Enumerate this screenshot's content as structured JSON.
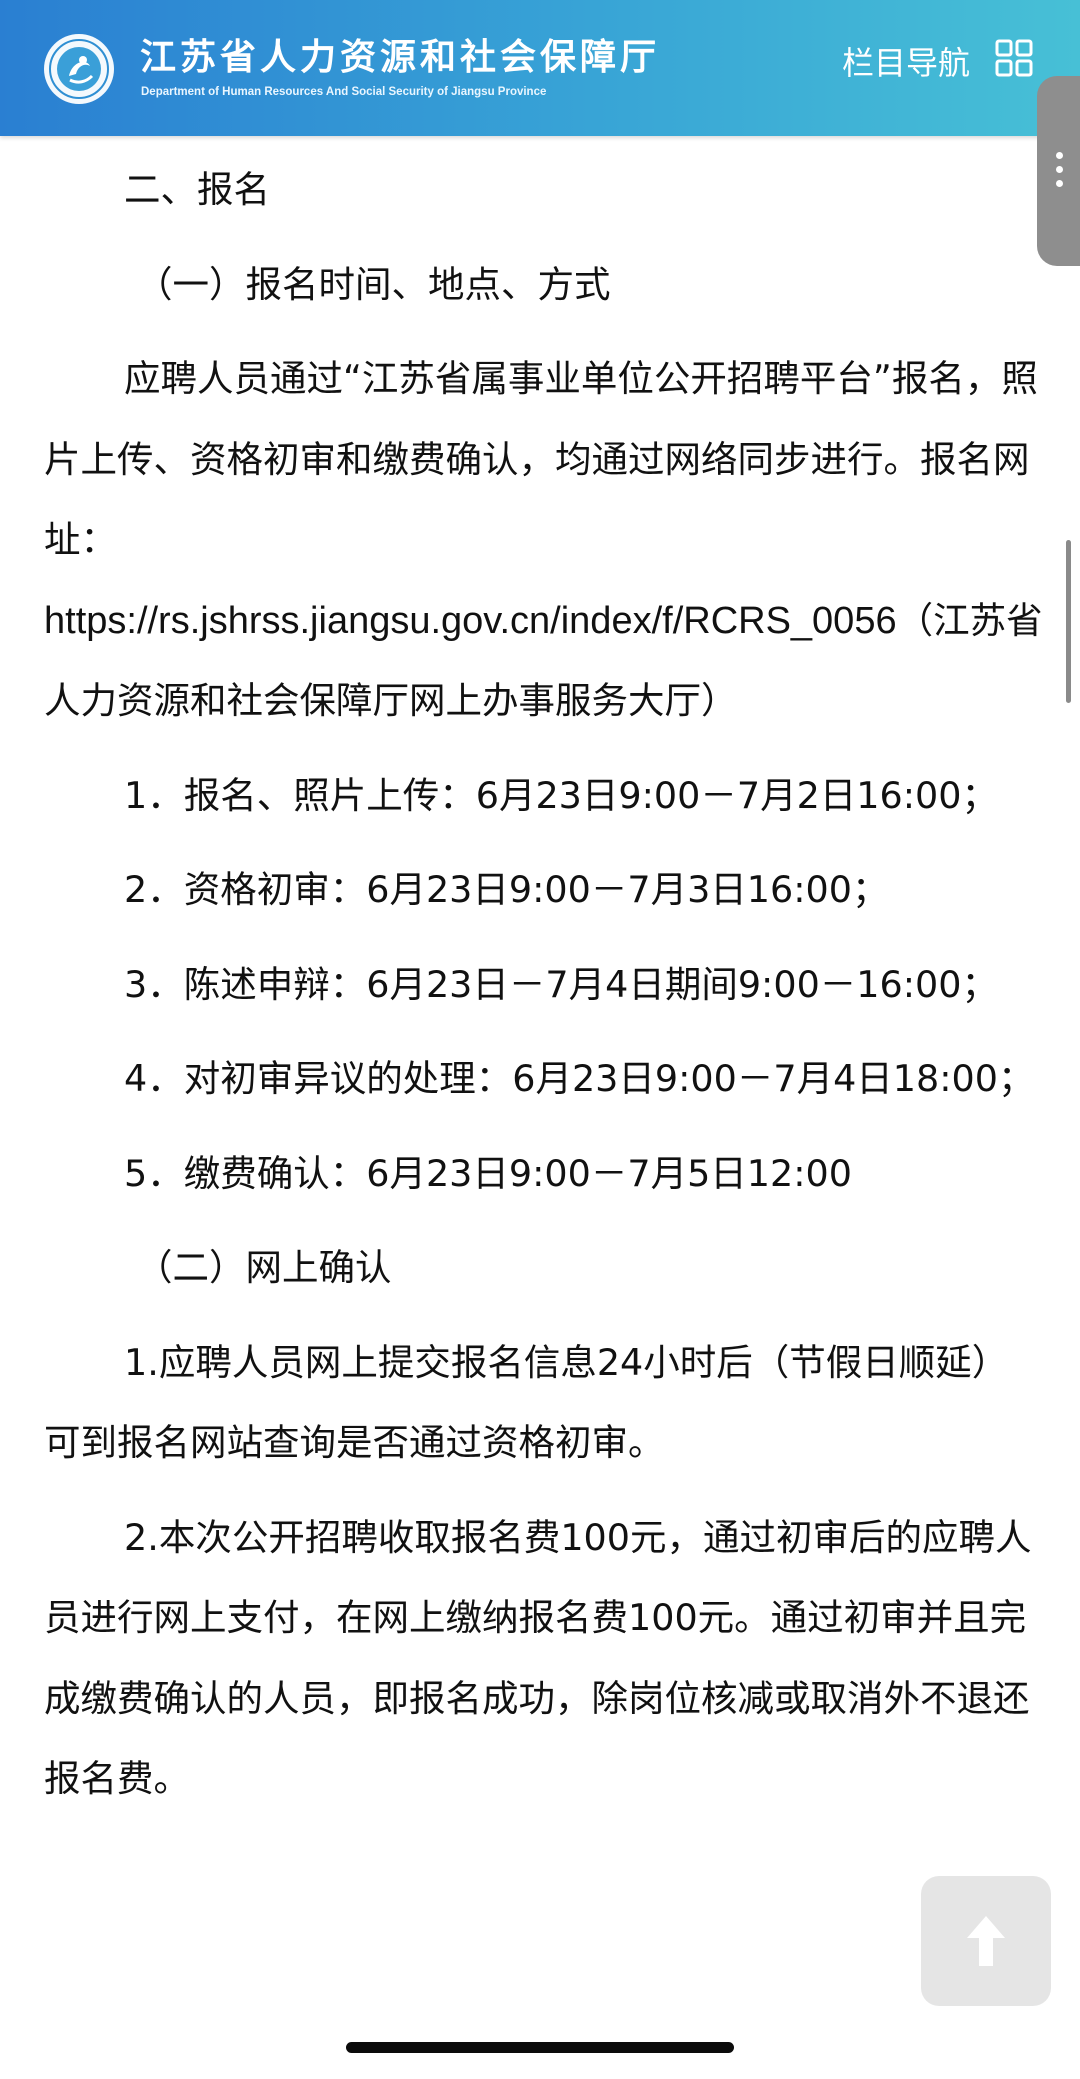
{
  "header": {
    "title_cn": "江苏省人力资源和社会保障厅",
    "title_en": "Department of Human Resources And Social Security of Jiangsu Province",
    "nav_label": "栏目导航",
    "logo_icon": "emblem-icon",
    "nav_icon": "grid-menu-icon",
    "gradient_start": "#2a7fd2",
    "gradient_end": "#47c0d6"
  },
  "article": {
    "section_title": "二、报名",
    "sub_heading_1": "（一）报名时间、地点、方式",
    "para_1": "应聘人员通过“江苏省属事业单位公开招聘平台”报名，照片上传、资格初审和缴费确认，均通过网络同步进行。报名网址：",
    "url": "https://rs.jshrss.jiangsu.gov.cn/index/f/RCRS_0056",
    "url_suffix": "（江苏省人力资源和社会保障厅网上办事服务大厅）",
    "item_1": "1．报名、照片上传：6月23日9:00－7月2日16:00；",
    "item_2": "2．资格初审：6月23日9:00－7月3日16:00；",
    "item_3": "3．陈述申辩：6月23日－7月4日期间9:00－16:00；",
    "item_4": "4．对初审异议的处理：6月23日9:00－7月4日18:00；",
    "item_5": "5．缴费确认：6月23日9:00－7月5日12:00",
    "sub_heading_2": "（二）网上确认",
    "confirm_1": "1.应聘人员网上提交报名信息24小时后（节假日顺延）可到报名网站查询是否通过资格初审。",
    "confirm_2": "2.本次公开招聘收取报名费100元，通过初审后的应聘人员进行网上支付，在网上缴纳报名费100元。通过初审并且完成缴费确认的人员，即报名成功，除岗位核减或取消外不退还报名费。"
  },
  "controls": {
    "side_menu_icon": "more-vertical-icon",
    "back_to_top_icon": "arrow-up-icon"
  }
}
